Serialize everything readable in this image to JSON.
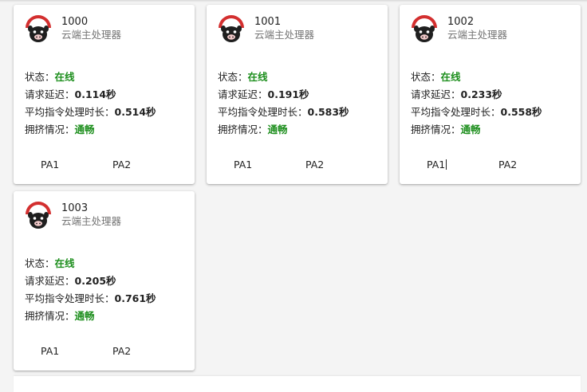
{
  "labels": {
    "status": "状态：",
    "latency": "请求延迟：",
    "avg_proc": "平均指令处理时长：",
    "congestion": "拥挤情况："
  },
  "colors": {
    "ok_green": "#1e8f1e",
    "avatar_red": "#d32f2f"
  },
  "cards": [
    {
      "id": "1000",
      "subtitle": "云端主处理器",
      "status": "在线",
      "latency": "0.114秒",
      "avg_proc": "0.514秒",
      "congestion": "通畅",
      "btn1": "PA1",
      "btn2": "PA2",
      "icon": "pig-avatar-icon"
    },
    {
      "id": "1001",
      "subtitle": "云端主处理器",
      "status": "在线",
      "latency": "0.191秒",
      "avg_proc": "0.583秒",
      "congestion": "通畅",
      "btn1": "PA1",
      "btn2": "PA2",
      "icon": "pig-avatar-icon"
    },
    {
      "id": "1002",
      "subtitle": "云端主处理器",
      "status": "在线",
      "latency": "0.233秒",
      "avg_proc": "0.558秒",
      "congestion": "通畅",
      "btn1": "PA1",
      "btn2": "PA2",
      "icon": "pig-avatar-icon"
    },
    {
      "id": "1003",
      "subtitle": "云端主处理器",
      "status": "在线",
      "latency": "0.205秒",
      "avg_proc": "0.761秒",
      "congestion": "通畅",
      "btn1": "PA1",
      "btn2": "PA2",
      "icon": "pig-avatar-icon"
    }
  ]
}
